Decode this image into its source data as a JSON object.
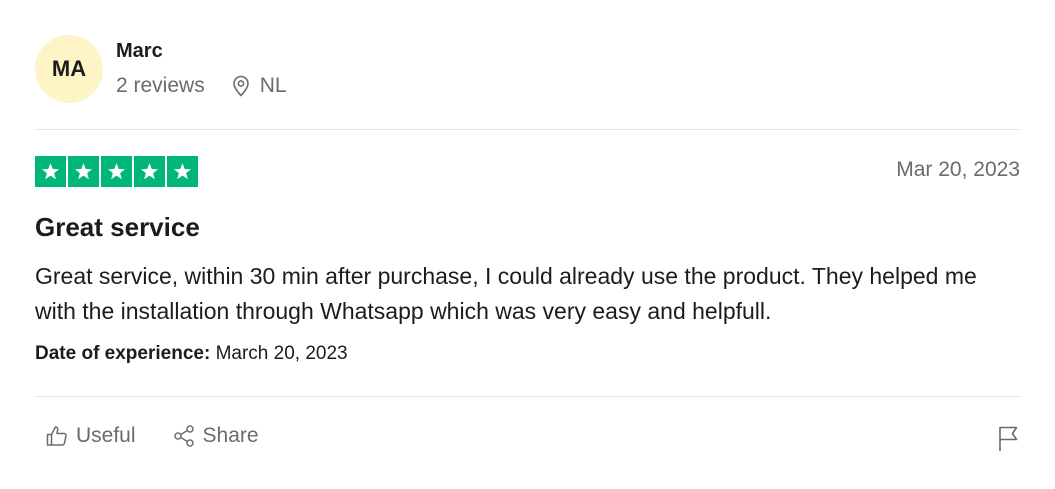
{
  "reviewer": {
    "initials": "MA",
    "name": "Marc",
    "reviews_count": "2 reviews",
    "location": "NL",
    "avatar_color": "#fff4c6"
  },
  "review": {
    "rating": 5,
    "max_rating": 5,
    "star_color": "#00b67a",
    "date": "Mar 20, 2023",
    "title": "Great service",
    "body": "Great service, within 30 min after purchase, I could already use the product. They helped me with the installation through Whatsapp which was very easy and helpfull.",
    "experience_label": "Date of experience:",
    "experience_date": "March 20, 2023"
  },
  "actions": {
    "useful_label": "Useful",
    "useful_icon": "thumbs-up-icon",
    "share_label": "Share",
    "share_icon": "share-icon",
    "report_icon": "flag-icon"
  }
}
